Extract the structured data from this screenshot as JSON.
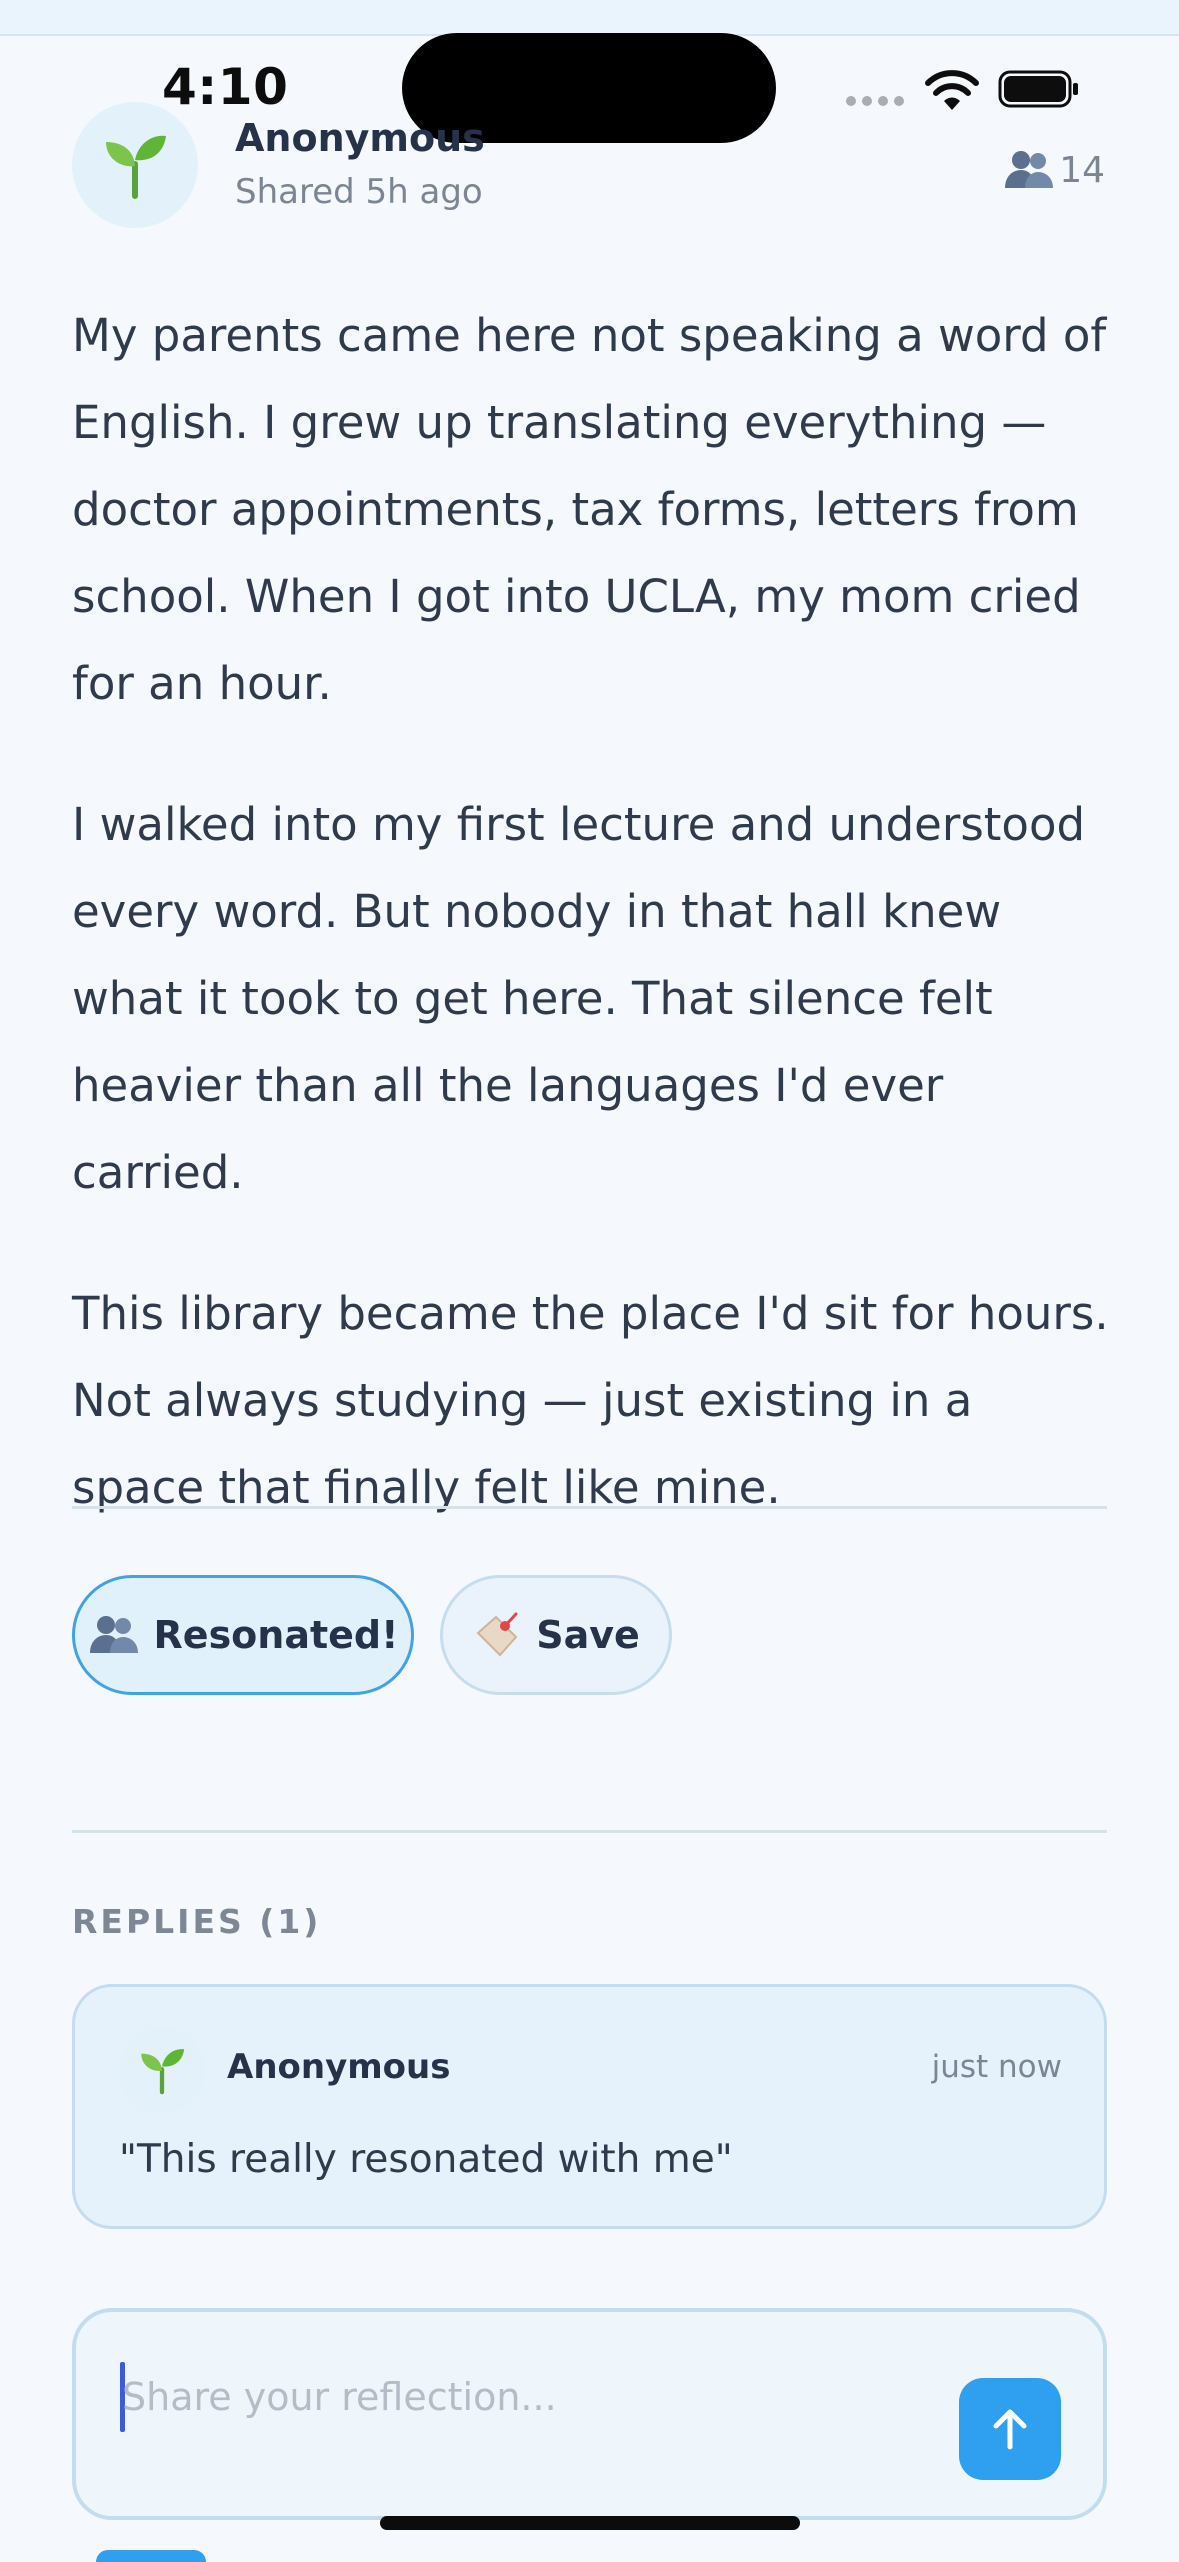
{
  "status_bar": {
    "time": "4:10"
  },
  "post": {
    "author": "Anonymous",
    "shared_time": "Shared 5h ago",
    "resonate_count": "14",
    "paragraphs": [
      "My parents came here not speaking a word of English. I grew up translating everything — doctor appointments, tax forms, letters from school. When I got into UCLA, my mom cried for an hour.",
      "I walked into my first lecture and understood every word. But nobody in that hall knew what it took to get here. That silence felt heavier than all the languages I'd ever carried.",
      "This library became the place I'd sit for hours. Not always studying — just existing in a space that finally felt like mine."
    ]
  },
  "actions": {
    "resonated_label": "Resonated!",
    "save_label": "Save"
  },
  "replies": {
    "heading": "REPLIES (1)",
    "items": [
      {
        "author": "Anonymous",
        "time": "just now",
        "text": "\"This really resonated with me\""
      }
    ]
  },
  "composer": {
    "placeholder": "Share your reflection..."
  },
  "icons": {
    "avatar": "seedling-icon",
    "resonate": "people-silhouettes-icon",
    "save": "bookmark-tag-icon",
    "send": "arrow-up-icon"
  },
  "colors": {
    "accent": "#2ea0ef",
    "background": "#f5f9fd",
    "card": "#e6f2fb"
  }
}
